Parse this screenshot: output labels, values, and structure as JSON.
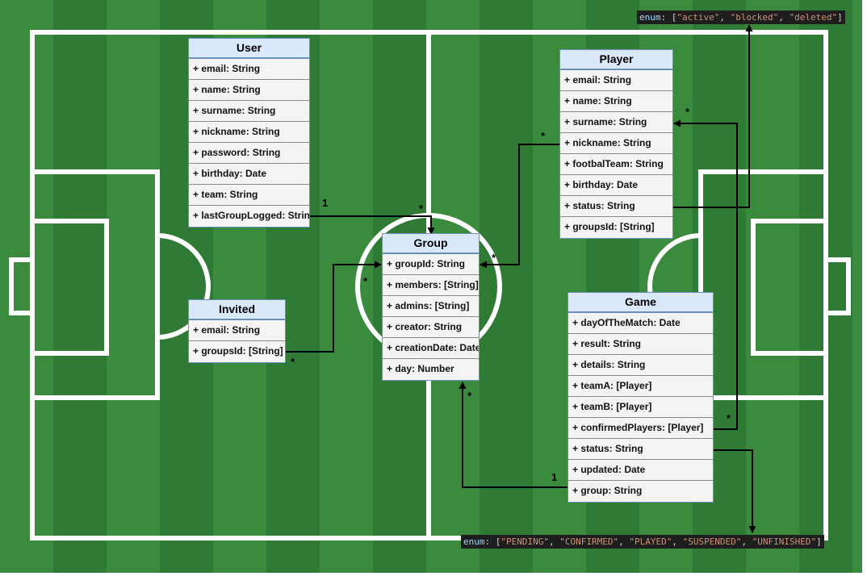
{
  "colors": {
    "field_light": "#3a8b3e",
    "field_dark": "#2f7a35",
    "entity_header": "#dae8fc",
    "entity_border": "#6c8ebf",
    "entity_body": "#f4f4f4"
  },
  "entities": {
    "user": {
      "title": "User",
      "fields": [
        "+ email: String",
        "+ name: String",
        "+ surname: String",
        "+ nickname: String",
        "+ password: String",
        "+ birthday: Date",
        "+ team: String",
        "+ lastGroupLogged: String"
      ]
    },
    "invited": {
      "title": "Invited",
      "fields": [
        "+ email: String",
        "+ groupsId: [String]"
      ]
    },
    "group": {
      "title": "Group",
      "fields": [
        "+ groupId: String",
        "+ members: [String]",
        "+ admins: [String]",
        "+ creator: String",
        "+ creationDate: Date",
        "+ day: Number"
      ]
    },
    "player": {
      "title": "Player",
      "fields": [
        "+ email: String",
        "+ name: String",
        "+ surname: String",
        "+ nickname: String",
        "+ footbalTeam: String",
        "+ birthday: Date",
        "+ status: String",
        "+ groupsId: [String]"
      ]
    },
    "game": {
      "title": "Game",
      "fields": [
        "+ dayOfTheMatch: Date",
        "+ result: String",
        "+ details: String",
        "+ teamA: [Player]",
        "+ teamB: [Player]",
        "+ confirmedPlayers: [Player]",
        "+ status: String",
        "+ updated: Date",
        "+ group: String"
      ]
    }
  },
  "multiplicities": {
    "user_group_src": "1",
    "user_group_dst": "*",
    "invited_group_src": "*",
    "invited_group_dst": "*",
    "player_group_src": "*",
    "player_group_dst": "*",
    "game_group_src": "1",
    "game_group_dst": "*",
    "game_player_src": "*",
    "game_player_dst": "*"
  },
  "enums": {
    "player_status": {
      "keyword": "enum:",
      "open": "[",
      "values": [
        "\"active\"",
        "\"blocked\"",
        "\"deleted\""
      ],
      "close": "]"
    },
    "game_status": {
      "keyword": "enum:",
      "open": "[",
      "values": [
        "\"PENDING\"",
        "\"CONFIRMED\"",
        "\"PLAYED\"",
        "\"SUSPENDED\"",
        "\"UNFINISHED\""
      ],
      "close": "]"
    }
  }
}
